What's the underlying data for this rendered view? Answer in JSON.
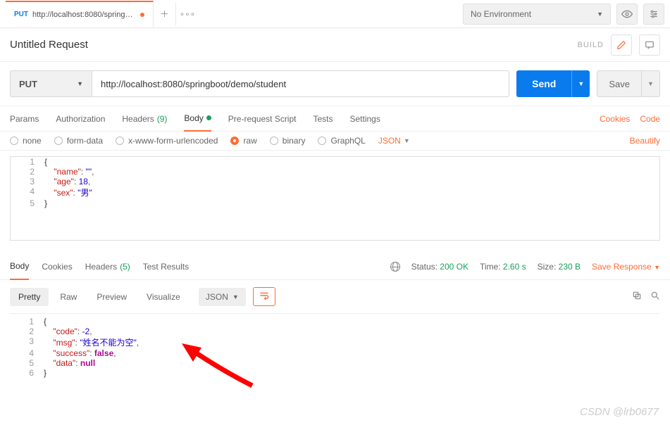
{
  "env": {
    "selected": "No Environment"
  },
  "tab": {
    "method": "PUT",
    "title": "http://localhost:8080/springboo…"
  },
  "request": {
    "title": "Untitled Request",
    "build": "BUILD",
    "method": "PUT",
    "url": "http://localhost:8080/springboot/demo/student",
    "send": "Send",
    "save": "Save"
  },
  "reqTabs": {
    "params": "Params",
    "auth": "Authorization",
    "headers": "Headers",
    "headersCount": "(9)",
    "body": "Body",
    "prereq": "Pre-request Script",
    "tests": "Tests",
    "settings": "Settings",
    "cookies": "Cookies",
    "code": "Code"
  },
  "bodyTypes": {
    "none": "none",
    "form": "form-data",
    "xwww": "x-www-form-urlencoded",
    "raw": "raw",
    "binary": "binary",
    "graphql": "GraphQL",
    "json": "JSON",
    "beautify": "Beautify"
  },
  "requestBody": {
    "l1": "{",
    "l2k": "\"name\"",
    "l2v": "\"\"",
    "l3k": "\"age\"",
    "l3v": "18",
    "l4k": "\"sex\"",
    "l4v": "\"男\"",
    "l5": "}"
  },
  "respTabs": {
    "body": "Body",
    "cookies": "Cookies",
    "headers": "Headers",
    "headersCount": "(5)",
    "testResults": "Test Results"
  },
  "respMeta": {
    "statusLabel": "Status:",
    "status": "200 OK",
    "timeLabel": "Time:",
    "time": "2.60 s",
    "sizeLabel": "Size:",
    "size": "230 B",
    "saveResponse": "Save Response"
  },
  "respViews": {
    "pretty": "Pretty",
    "raw": "Raw",
    "preview": "Preview",
    "visualize": "Visualize",
    "json": "JSON"
  },
  "responseBody": {
    "l1": "{",
    "l2k": "\"code\"",
    "l2v": "-2",
    "l3k": "\"msg\"",
    "l3v": "\"姓名不能为空\"",
    "l4k": "\"success\"",
    "l4v": "false",
    "l5k": "\"data\"",
    "l5v": "null",
    "l6": "}"
  },
  "watermark": "CSDN @lrb0677"
}
